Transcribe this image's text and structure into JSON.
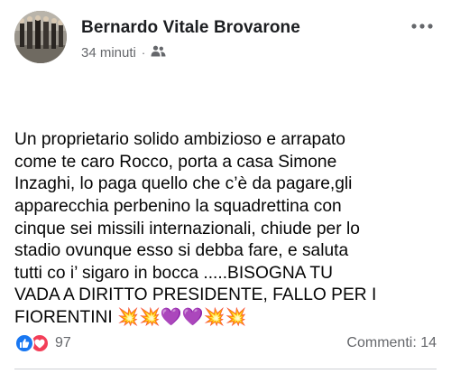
{
  "post": {
    "author": "Bernardo Vitale Brovarone",
    "time": "34 minuti",
    "separator": "·",
    "audience_icon": "friends-icon",
    "more_icon": "more-options-icon",
    "body": "Un proprietario solido ambizioso e arrapato\ncome te caro Rocco, porta a casa Simone\nInzaghi, lo paga quello che c’è da pagare,gli\napparecchia perbenino la squadrettina con\ncinque sei missili internazionali, chiude per lo\nstadio ovunque esso si debba fare, e saluta\ntutti co i’ sigaro in bocca .....BISOGNA TU\nVADA A DIRITTO PRESIDENTE, FALLO PER I\nFIORENTINI 💥💥💜💜💥💥"
  },
  "footer": {
    "reaction_icons": [
      "like-icon",
      "love-icon"
    ],
    "reaction_count": "97",
    "comments_label": "Commenti: 14"
  },
  "colors": {
    "like": "#1877f2",
    "love": "#f33e58",
    "secondary_text": "#65676b",
    "divider": "#ced0d4"
  }
}
